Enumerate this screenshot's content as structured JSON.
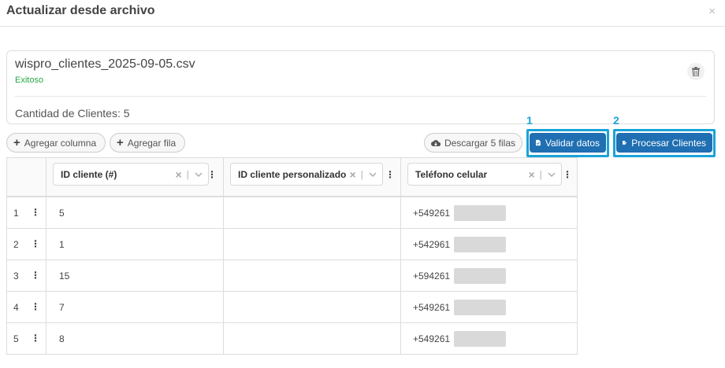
{
  "modal": {
    "title": "Actualizar desde archivo",
    "close_glyph": "×"
  },
  "file": {
    "name": "wispro_clientes_2025-09-05.csv",
    "status": "Exitoso",
    "status_color": "#28a745",
    "count_label": "Cantidad de Clientes: 5"
  },
  "toolbar": {
    "add_column_label": "Agregar columna",
    "add_row_label": "Agregar fila",
    "download_label": "Descargar 5 filas",
    "validate_label": "Validar datos",
    "process_label": "Procesar Clientes",
    "step_1": "1",
    "step_2": "2",
    "accent_color": "#1f6fb2",
    "highlight_color": "#19a3d8"
  },
  "grid": {
    "columns": [
      {
        "label": "ID cliente (#)"
      },
      {
        "label": "ID cliente personalizado"
      },
      {
        "label": "Teléfono celular"
      }
    ],
    "rows": [
      {
        "num": "1",
        "id": "5",
        "custom_id": "",
        "phone": "+549261"
      },
      {
        "num": "2",
        "id": "1",
        "custom_id": "",
        "phone": "+542961"
      },
      {
        "num": "3",
        "id": "15",
        "custom_id": "",
        "phone": "+594261"
      },
      {
        "num": "4",
        "id": "7",
        "custom_id": "",
        "phone": "+549261"
      },
      {
        "num": "5",
        "id": "8",
        "custom_id": "",
        "phone": "+549261"
      }
    ]
  }
}
